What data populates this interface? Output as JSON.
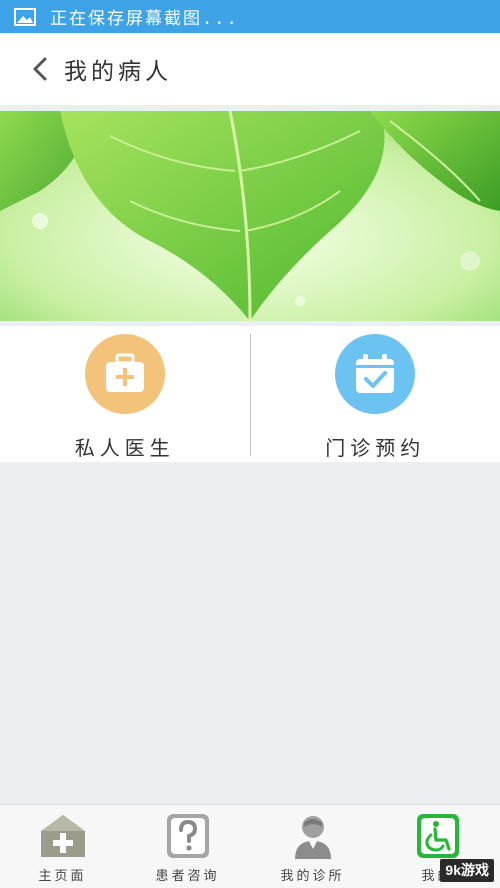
{
  "status_bar": {
    "text": "正在保存屏幕截图...",
    "icon": "image-icon",
    "color": "#3ea2e6"
  },
  "header": {
    "back_icon": "chevron-left-icon",
    "title": "我的病人"
  },
  "banner": {
    "image": "green-leaves-banner"
  },
  "menu": {
    "items": [
      {
        "label": "私人医生",
        "icon": "medical-kit-icon",
        "color": "#f3c37b"
      },
      {
        "label": "门诊预约",
        "icon": "calendar-check-icon",
        "color": "#6cc2f0"
      }
    ]
  },
  "bottom_nav": {
    "items": [
      {
        "label": "主页面",
        "icon": "home-plus-icon"
      },
      {
        "label": "患者咨询",
        "icon": "question-icon"
      },
      {
        "label": "我的诊所",
        "icon": "doctor-icon"
      },
      {
        "label": "我的",
        "icon": "wheelchair-icon",
        "active": true,
        "active_color": "#27b53a"
      }
    ]
  },
  "watermark": "9k游戏"
}
